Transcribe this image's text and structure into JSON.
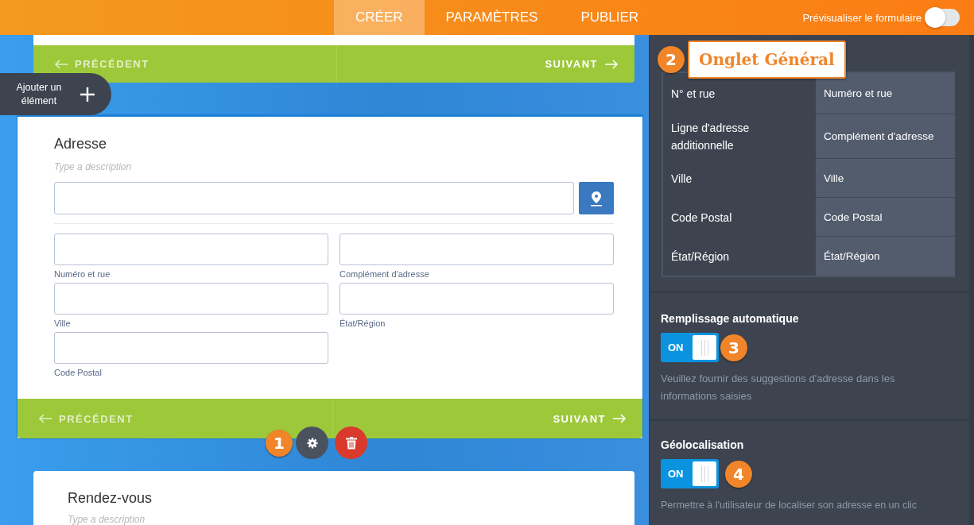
{
  "header": {
    "tabs": [
      {
        "label": "CRÉER",
        "selected": true
      },
      {
        "label": "PARAMÈTRES",
        "selected": false
      },
      {
        "label": "PUBLIER",
        "selected": false
      }
    ],
    "preview": {
      "label": "Prévisualiser le formulaire",
      "on": false
    }
  },
  "canvas": {
    "top_nav": {
      "previous": "PRÉCÉDENT",
      "next": "SUIVANT"
    },
    "add_element": "Ajouter un élément",
    "address_card": {
      "selected": true,
      "title": "Adresse",
      "description_placeholder": "Type a description",
      "fields": [
        {
          "label": "Numéro et rue"
        },
        {
          "label": "Complément d'adresse"
        },
        {
          "label": "Ville"
        },
        {
          "label": "État/Région"
        },
        {
          "label": "Code Postal"
        }
      ],
      "previous": "PRÉCÉDENT",
      "next": "SUIVANT"
    },
    "tools": {
      "marker": "1"
    },
    "next_card": {
      "title": "Rendez-vous",
      "description_placeholder": "Type a description"
    }
  },
  "panel": {
    "callout": {
      "marker": "2",
      "label": "Onglet Général"
    },
    "label_table": [
      {
        "field": "N° et rue",
        "label": "Numéro et rue"
      },
      {
        "field": "Ligne d'adresse additionnelle",
        "label": "Complément d'adresse"
      },
      {
        "field": "Ville",
        "label": "Ville"
      },
      {
        "field": "Code Postal",
        "label": "Code Postal"
      },
      {
        "field": "État/Région",
        "label": "État/Région"
      }
    ],
    "settings": [
      {
        "title": "Remplissage automatique",
        "on": true,
        "state_label": "ON",
        "marker": "3",
        "description": "Veuillez fournir des suggestions d'adresse dans les informations saisies"
      },
      {
        "title": "Géolocalisation",
        "on": true,
        "state_label": "ON",
        "marker": "4",
        "description": "Permettre à l'utilisateur de localiser son adresse en un clic"
      }
    ]
  }
}
